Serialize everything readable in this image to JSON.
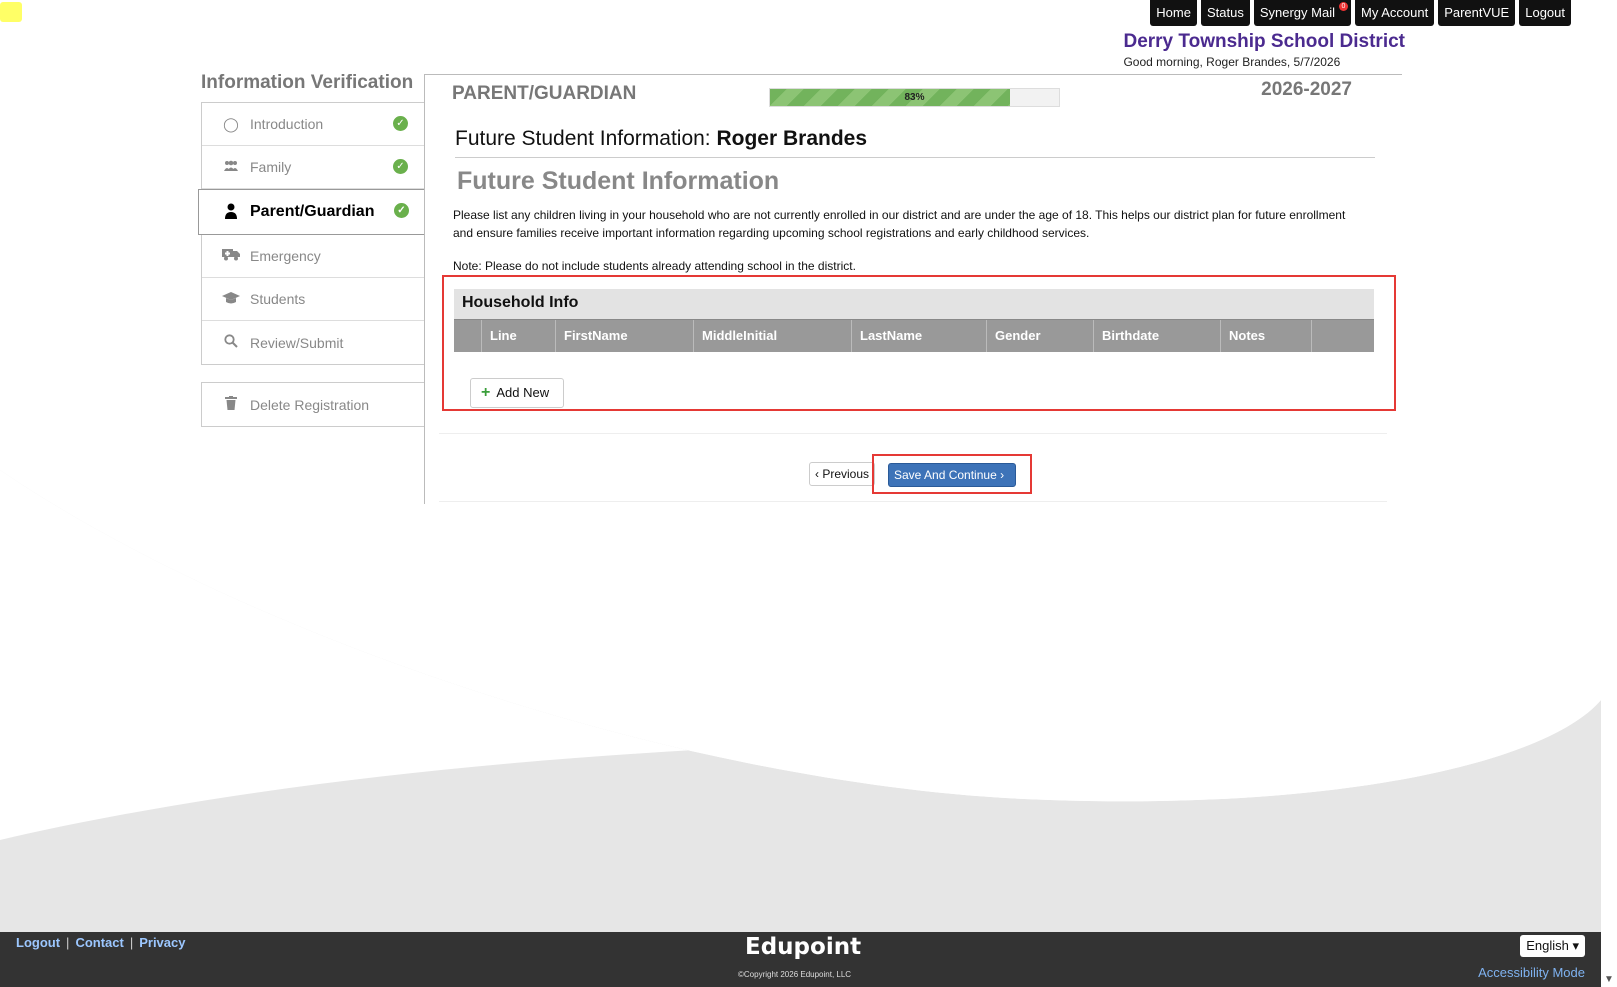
{
  "top_nav": {
    "home": "Home",
    "status": "Status",
    "synergy_mail": "Synergy Mail",
    "mail_badge": "0",
    "my_account": "My Account",
    "parentvue": "ParentVUE",
    "logout": "Logout"
  },
  "district": {
    "name": "Derry Township School District",
    "greeting": "Good morning, Roger Brandes, 5/7/2026"
  },
  "sidebar": {
    "title": "Information Verification",
    "items": [
      {
        "label": "Introduction",
        "icon": "lightbulb-icon",
        "done": true
      },
      {
        "label": "Family",
        "icon": "users-icon",
        "done": true
      },
      {
        "label": "Parent/Guardian",
        "icon": "user-icon",
        "done": true,
        "active": true
      },
      {
        "label": "Emergency",
        "icon": "ambulance-icon",
        "done": false
      },
      {
        "label": "Students",
        "icon": "graduation-cap-icon",
        "done": false
      },
      {
        "label": "Review/Submit",
        "icon": "search-icon",
        "done": false
      }
    ],
    "delete_label": "Delete Registration"
  },
  "main": {
    "section_title": "PARENT/GUARDIAN",
    "progress_percent": 83,
    "progress_label": "83%",
    "school_year": "2026-2027",
    "page_title_prefix": "Future Student Information: ",
    "page_title_name": "Roger Brandes",
    "sub_heading": "Future Student Information",
    "description": "Please list any children living in your household who are not currently enrolled in our district and are under the age of 18. This helps our district plan for future enrollment and ensure families receive important information regarding upcoming school registrations and early childhood services.",
    "note": "Note: Please do not include students already attending school in the district.",
    "household": {
      "title": "Household Info",
      "columns": [
        "",
        "Line",
        "FirstName",
        "MiddleInitial",
        "LastName",
        "Gender",
        "Birthdate",
        "Notes",
        ""
      ],
      "add_new": "Add New"
    },
    "previous": "Previous",
    "save_continue": "Save And Continue"
  },
  "footer": {
    "logout": "Logout",
    "contact": "Contact",
    "privacy": "Privacy",
    "brand": "Edupoint",
    "copyright": "©Copyright 2026 Edupoint, LLC",
    "language": "English",
    "accessibility": "Accessibility Mode"
  },
  "colors": {
    "district_purple": "#4b2a8f",
    "progress_green": "#72b35c",
    "save_blue": "#3d73b8",
    "highlight_red": "#e53935",
    "footer_bg": "#333333"
  }
}
